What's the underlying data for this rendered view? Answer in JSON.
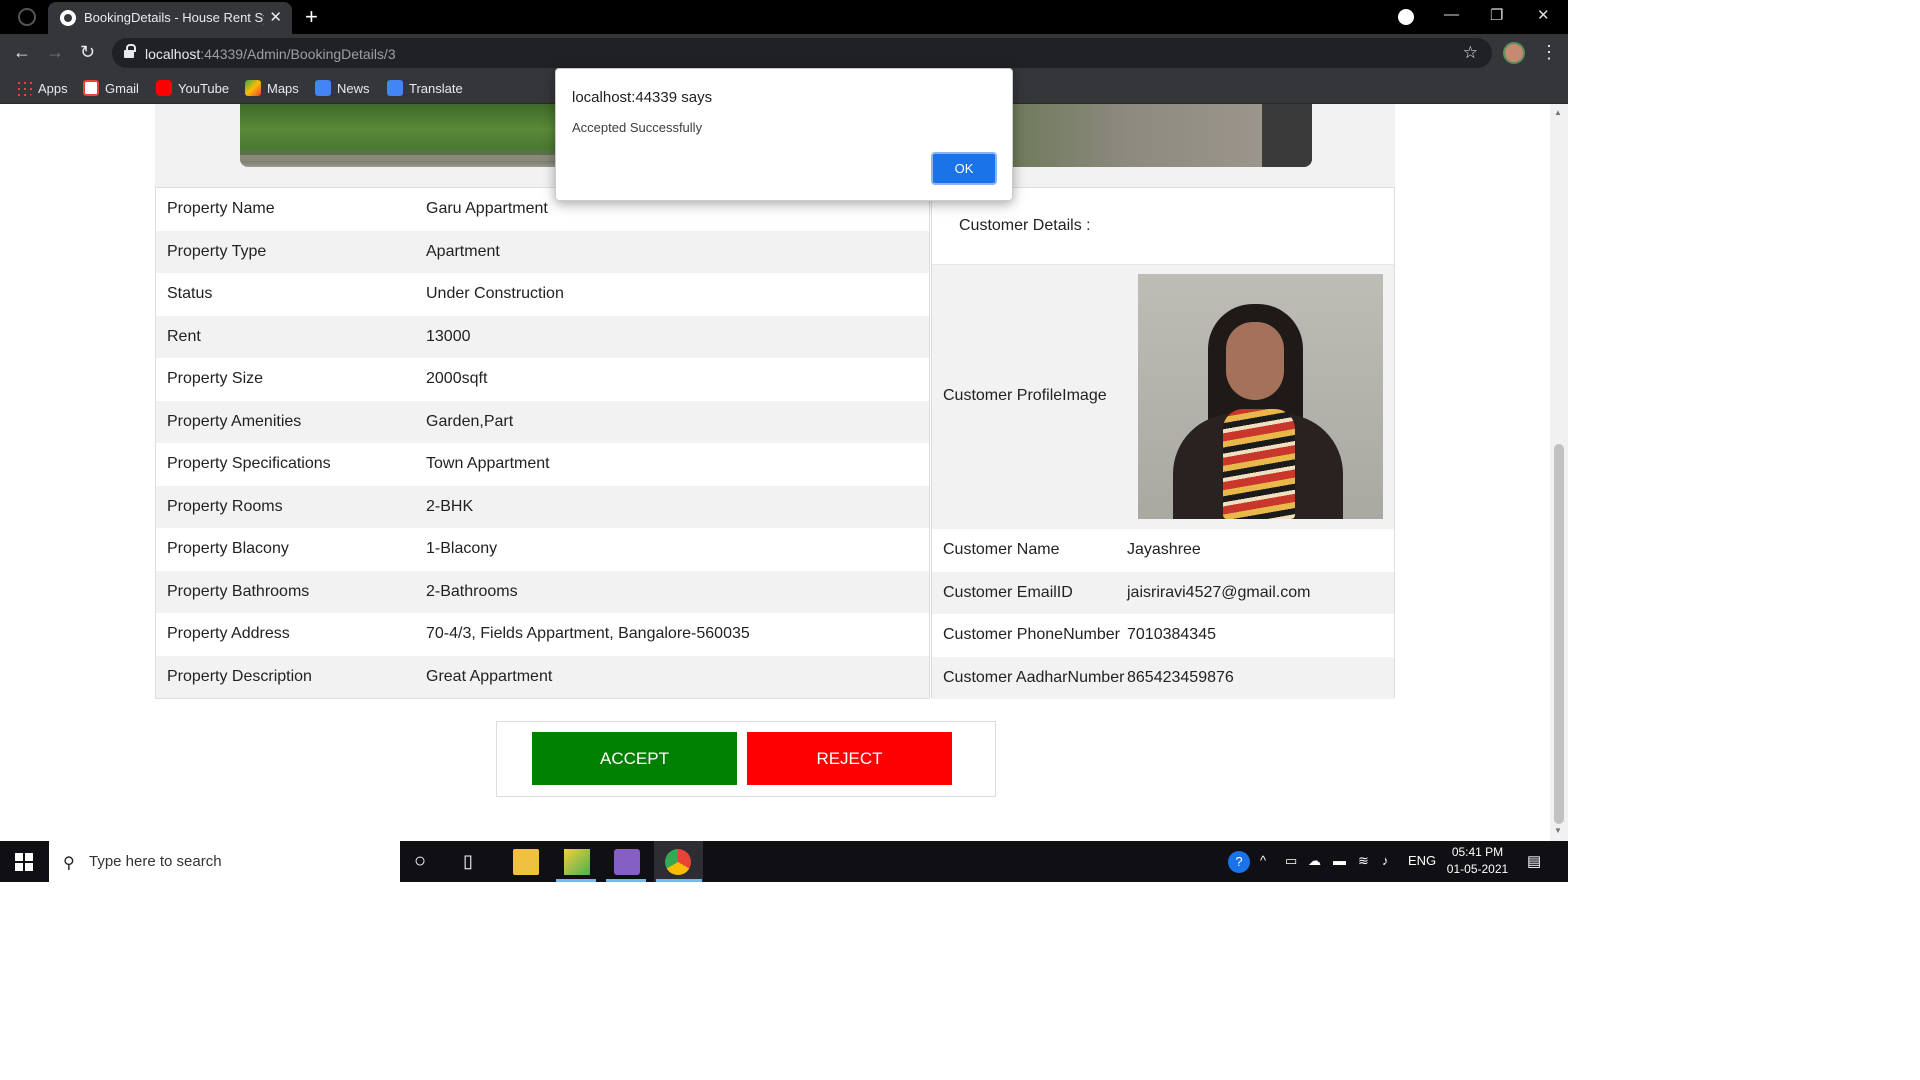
{
  "browser": {
    "tab_title": "BookingDetails - House Rent Syst",
    "url_host": "localhost",
    "url_rest": ":44339/Admin/BookingDetails/3",
    "bookmarks": [
      "Apps",
      "Gmail",
      "YouTube",
      "Maps",
      "News",
      "Translate"
    ]
  },
  "property": {
    "rows": [
      {
        "label": "Property Name",
        "value": "Garu Appartment"
      },
      {
        "label": "Property Type",
        "value": "Apartment"
      },
      {
        "label": "Status",
        "value": "Under Construction"
      },
      {
        "label": "Rent",
        "value": "13000"
      },
      {
        "label": "Property Size",
        "value": "2000sqft"
      },
      {
        "label": "Property Amenities",
        "value": "Garden,Part"
      },
      {
        "label": "Property Specifications",
        "value": "Town Appartment"
      },
      {
        "label": "Property Rooms",
        "value": "2-BHK"
      },
      {
        "label": "Property Blacony",
        "value": "1-Blacony"
      },
      {
        "label": "Property Bathrooms",
        "value": "2-Bathrooms"
      },
      {
        "label": "Property Address",
        "value": "70-4/3, Fields Appartment, Bangalore-560035"
      },
      {
        "label": "Property Description",
        "value": "Great Appartment"
      }
    ]
  },
  "customer": {
    "heading": "Customer Details :",
    "image_label": "Customer ProfileImage",
    "rows": [
      {
        "label": "Customer Name",
        "value": "Jayashree"
      },
      {
        "label": "Customer EmailID",
        "value": "jaisriravi4527@gmail.com"
      },
      {
        "label": "Customer PhoneNumber",
        "value": "7010384345"
      },
      {
        "label": "Customer AadharNumber",
        "value": "865423459876"
      }
    ]
  },
  "actions": {
    "accept": "ACCEPT",
    "reject": "REJECT"
  },
  "alert": {
    "title": "localhost:44339 says",
    "message": "Accepted Successfully",
    "ok": "OK"
  },
  "taskbar": {
    "search_placeholder": "Type here to search",
    "lang": "ENG",
    "time": "05:41 PM",
    "date": "01-05-2021"
  }
}
